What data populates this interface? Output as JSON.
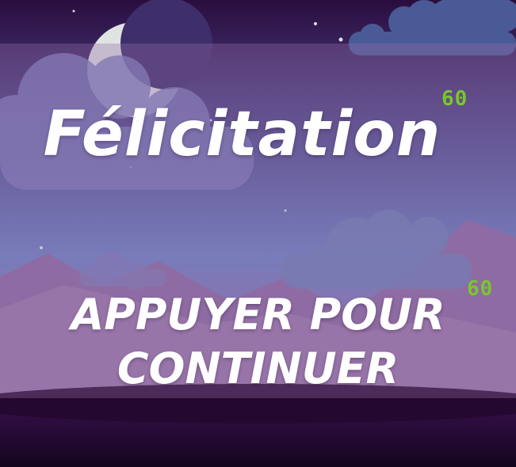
{
  "title": "Félicitation",
  "continue_prompt": {
    "line1": "APPUYER POUR",
    "line2": "CONTINUER"
  },
  "fps_counters": [
    "60",
    "60"
  ],
  "colors": {
    "fps_text": "#7ac72a",
    "title_text": "#ffffff",
    "sky_top": "#4a3a7a",
    "sky_bottom": "#7a9ad0",
    "ground": "#2a0a3a"
  },
  "icons": [
    "moon-icon",
    "cloud-icon",
    "mountain-icon",
    "star-icon"
  ]
}
